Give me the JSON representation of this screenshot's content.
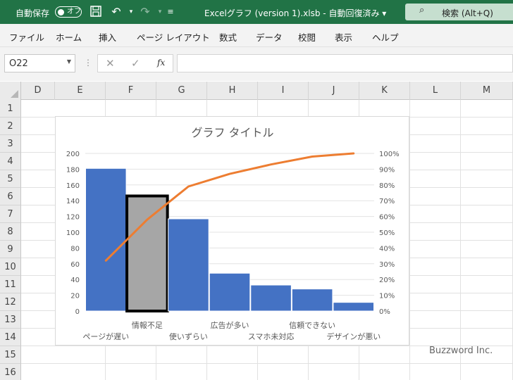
{
  "titlebar": {
    "autosave_label": "自動保存",
    "autosave_state": "オフ",
    "filename": "Excelグラフ (version 1).xlsb  -  自動回復済み",
    "search_label": "検索 (Alt+Q)"
  },
  "menu": [
    "ファイル",
    "ホーム",
    "挿入",
    "ページ レイアウト",
    "数式",
    "データ",
    "校閲",
    "表示",
    "ヘルプ"
  ],
  "formula_bar": {
    "name_box": "O22",
    "fx": "fx",
    "formula": ""
  },
  "columns": [
    "D",
    "E",
    "F",
    "G",
    "H",
    "I",
    "J",
    "K",
    "L",
    "M"
  ],
  "rows": [
    "1",
    "2",
    "3",
    "4",
    "5",
    "6",
    "7",
    "8",
    "9",
    "10",
    "11",
    "12",
    "13",
    "14",
    "15",
    "16"
  ],
  "colors": {
    "ribbon": "#217346",
    "bar": "#4472c4",
    "selected_bar": "#a6a6a6",
    "line": "#ed7d31"
  },
  "chart_data": {
    "type": "bar",
    "title": "グラフ タイトル",
    "categories": [
      "ページが遅い",
      "情報不足",
      "使いずらい",
      "広告が多い",
      "スマホ未対応",
      "信頼できない",
      "デザインが悪い"
    ],
    "values": [
      181,
      146,
      117,
      48,
      33,
      28,
      11
    ],
    "cumulative_percent": [
      32,
      58,
      79,
      87,
      93,
      98,
      100
    ],
    "ylim": [
      0,
      200
    ],
    "y_ticks": [
      "0",
      "20",
      "40",
      "60",
      "80",
      "100",
      "120",
      "140",
      "160",
      "180",
      "200"
    ],
    "y2_ticks": [
      "0%",
      "10%",
      "20%",
      "30%",
      "40%",
      "50%",
      "60%",
      "70%",
      "80%",
      "90%",
      "100%"
    ],
    "selected_index": 1,
    "grid": true
  },
  "watermark": "Buzzword Inc."
}
